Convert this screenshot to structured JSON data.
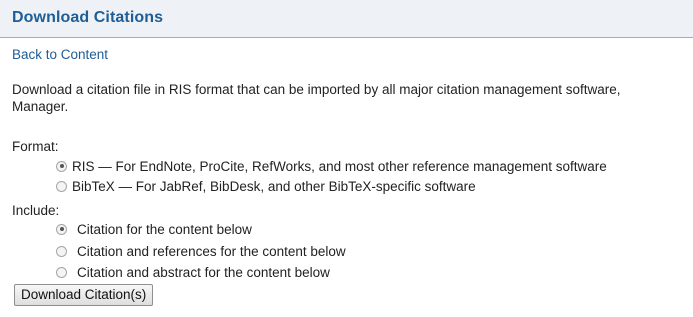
{
  "header": {
    "title": "Download Citations"
  },
  "back_link": "Back to Content",
  "description": {
    "line1": "Download a citation file in RIS format that can be imported by all major citation management software,",
    "line2": "Manager."
  },
  "format": {
    "label": "Format:",
    "options": [
      {
        "label": "RIS — For EndNote, ProCite, RefWorks, and most other reference management software",
        "checked": true
      },
      {
        "label": "BibTeX — For JabRef, BibDesk, and other BibTeX-specific software",
        "checked": false
      }
    ]
  },
  "include": {
    "label": "Include:",
    "options": [
      {
        "label": "Citation for the content below",
        "checked": true
      },
      {
        "label": "Citation and references for the content below",
        "checked": false
      },
      {
        "label": "Citation and abstract for the content below",
        "checked": false
      }
    ]
  },
  "download_button": "Download Citation(s)"
}
